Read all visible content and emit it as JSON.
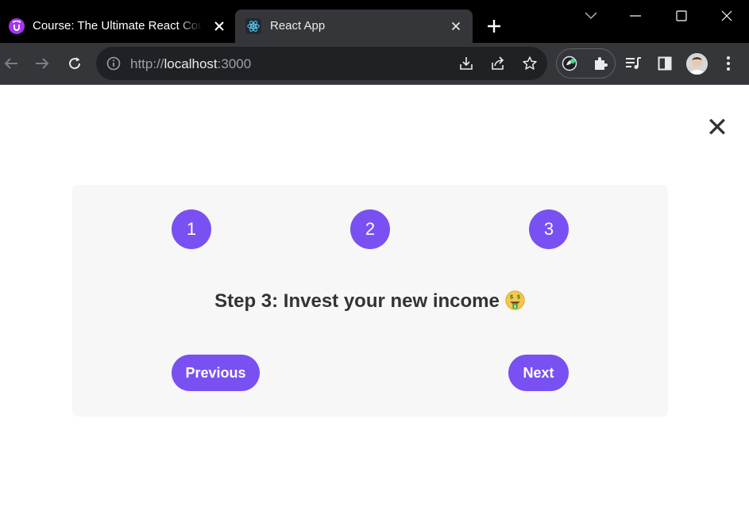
{
  "tabs": [
    {
      "title": "Course: The Ultimate React Course",
      "favicon": "udemy-icon",
      "active": false
    },
    {
      "title": "React App",
      "favicon": "react-icon",
      "active": true
    }
  ],
  "address_bar": {
    "url_scheme": "http://",
    "url_host": "localhost",
    "url_port": ":3000"
  },
  "app": {
    "steps": [
      "1",
      "2",
      "3"
    ],
    "current_step": 3,
    "message": "Step 3: Invest your new income",
    "emoji": "money-mouth-face-icon",
    "previous_label": "Previous",
    "next_label": "Next",
    "close_symbol": "✕"
  },
  "colors": {
    "accent": "#7950f2",
    "card_background": "#f7f7f7",
    "text": "#333333"
  }
}
